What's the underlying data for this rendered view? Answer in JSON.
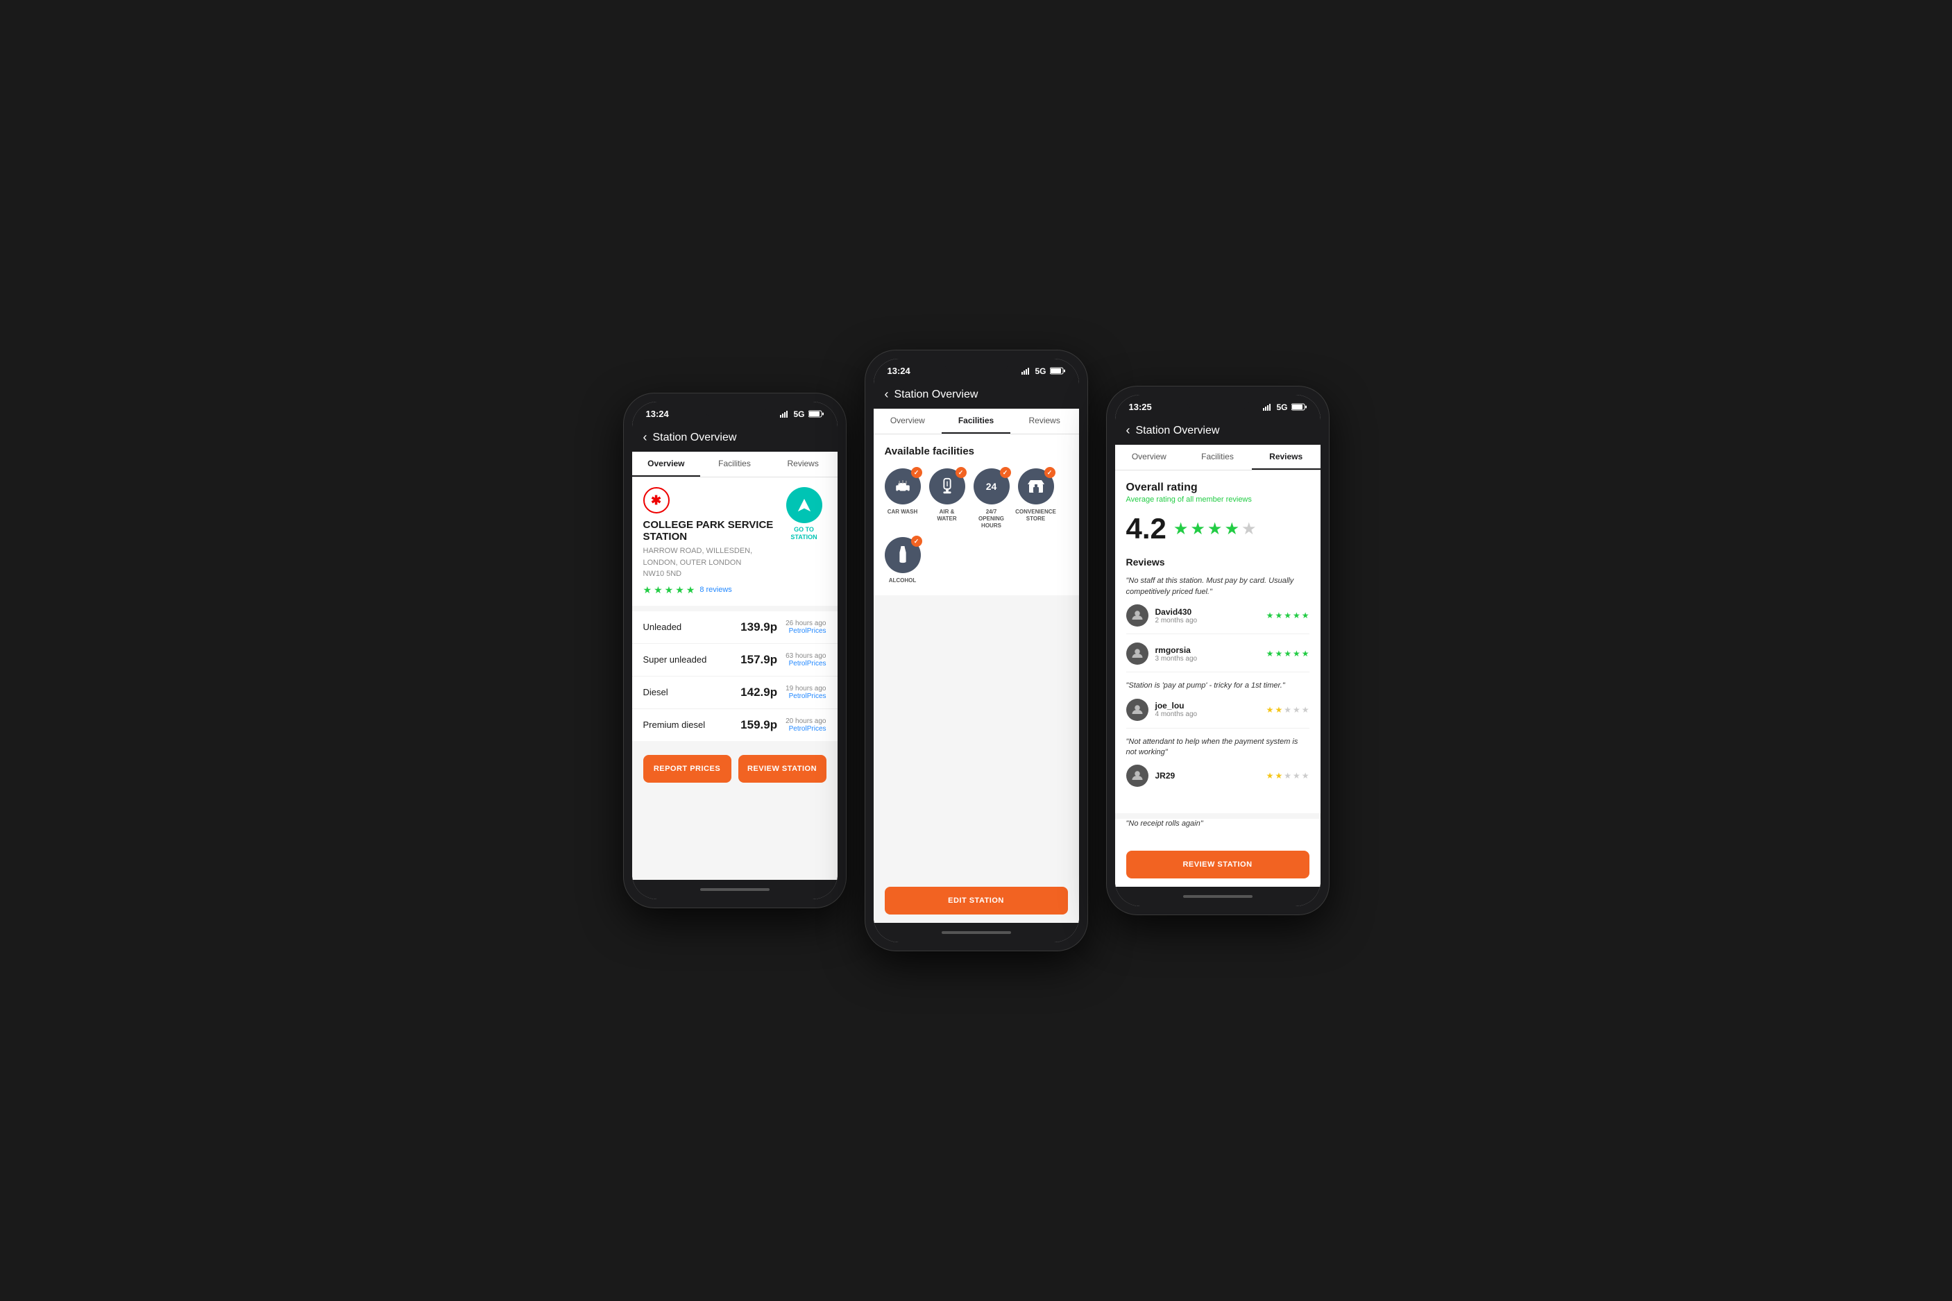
{
  "phones": [
    {
      "id": "phone1",
      "statusBar": {
        "time": "13:24",
        "signal": "5G"
      },
      "header": {
        "back": "‹",
        "title": "Station Overview"
      },
      "tabs": [
        {
          "label": "Overview",
          "active": true
        },
        {
          "label": "Facilities",
          "active": false
        },
        {
          "label": "Reviews",
          "active": false
        }
      ],
      "station": {
        "name": "COLLEGE PARK SERVICE STATION",
        "address": "HARROW ROAD, WILLESDEN, LONDON, OUTER LONDON",
        "postcode": "NW10 5ND",
        "reviewCount": "8 reviews",
        "goToLabel": "GO TO\nSTATION"
      },
      "fuels": [
        {
          "name": "Unleaded",
          "price": "139.9p",
          "time": "26 hours ago",
          "source": "PetrolPrices"
        },
        {
          "name": "Super unleaded",
          "price": "157.9p",
          "time": "63 hours ago",
          "source": "PetrolPrices"
        },
        {
          "name": "Diesel",
          "price": "142.9p",
          "time": "19 hours ago",
          "source": "PetrolPrices"
        },
        {
          "name": "Premium diesel",
          "price": "159.9p",
          "time": "20 hours ago",
          "source": "PetrolPrices"
        }
      ],
      "buttons": [
        {
          "label": "REPORT PRICES"
        },
        {
          "label": "REVIEW STATION"
        }
      ]
    },
    {
      "id": "phone2",
      "statusBar": {
        "time": "13:24",
        "signal": "5G"
      },
      "header": {
        "back": "‹",
        "title": "Station Overview"
      },
      "tabs": [
        {
          "label": "Overview",
          "active": false
        },
        {
          "label": "Facilities",
          "active": true
        },
        {
          "label": "Reviews",
          "active": false
        }
      ],
      "facilitiesTitle": "Available facilities",
      "facilities": [
        {
          "label": "CAR WASH",
          "icon": "🚗",
          "checked": true
        },
        {
          "label": "AIR & WATER",
          "icon": "💨",
          "checked": true
        },
        {
          "label": "24/7 OPENING HOURS",
          "icon": "⏰",
          "checked": true
        },
        {
          "label": "CONVENIENCE STORE",
          "icon": "🛒",
          "checked": true
        },
        {
          "label": "ALCOHOL",
          "icon": "🍷",
          "checked": true
        }
      ],
      "editButton": {
        "label": "EDIT STATION"
      }
    },
    {
      "id": "phone3",
      "statusBar": {
        "time": "13:25",
        "signal": "5G"
      },
      "header": {
        "back": "‹",
        "title": "Station Overview"
      },
      "tabs": [
        {
          "label": "Overview",
          "active": false
        },
        {
          "label": "Facilities",
          "active": false
        },
        {
          "label": "Reviews",
          "active": true
        }
      ],
      "overallRating": {
        "title": "Overall rating",
        "subtitle": "Average rating of all member reviews",
        "score": "4.2",
        "starsCount": 4,
        "hasHalf": false,
        "emptyStars": 1
      },
      "reviewsLabel": "Reviews",
      "reviews": [
        {
          "quote": "\"No staff at this station. Must pay by card. Usually competitively priced fuel.\"",
          "reviewer": "David430",
          "time": "2 months ago",
          "stars": 5,
          "starColor": "green"
        },
        {
          "quote": null,
          "reviewer": "rmgorsia",
          "time": "3 months ago",
          "stars": 5,
          "starColor": "green"
        },
        {
          "quote": "\"Station is 'pay at pump' - tricky for a 1st timer.\"",
          "reviewer": "joe_lou",
          "time": "4 months ago",
          "stars": 2,
          "starColor": "yellow"
        },
        {
          "quote": "\"Not attendant to help when the payment system is not working\"",
          "reviewer": "JR29",
          "time": null,
          "stars": 2,
          "starColor": "yellow"
        },
        {
          "quote": "\"No receipt rolls again\"",
          "reviewer": null,
          "time": null,
          "stars": null,
          "starColor": null
        }
      ],
      "reviewButton": {
        "label": "REVIEW STATION"
      }
    }
  ]
}
